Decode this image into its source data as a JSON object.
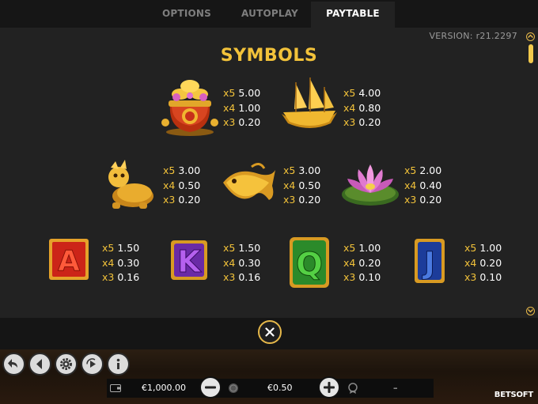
{
  "tabs": [
    {
      "label": "OPTIONS",
      "active": false
    },
    {
      "label": "AUTOPLAY",
      "active": false
    },
    {
      "label": "PAYTABLE",
      "active": true
    }
  ],
  "version": "VERSION: r21.2297",
  "section_title": "SYMBOLS",
  "symbols": [
    {
      "name": "treasure-pot",
      "pays": [
        {
          "mult": "x5",
          "value": "5.00"
        },
        {
          "mult": "x4",
          "value": "1.00"
        },
        {
          "mult": "x3",
          "value": "0.20"
        }
      ]
    },
    {
      "name": "golden-ship",
      "pays": [
        {
          "mult": "x5",
          "value": "4.00"
        },
        {
          "mult": "x4",
          "value": "0.80"
        },
        {
          "mult": "x3",
          "value": "0.20"
        }
      ]
    },
    {
      "name": "dragon-turtle",
      "pays": [
        {
          "mult": "x5",
          "value": "3.00"
        },
        {
          "mult": "x4",
          "value": "0.50"
        },
        {
          "mult": "x3",
          "value": "0.20"
        }
      ]
    },
    {
      "name": "golden-fish",
      "pays": [
        {
          "mult": "x5",
          "value": "3.00"
        },
        {
          "mult": "x4",
          "value": "0.50"
        },
        {
          "mult": "x3",
          "value": "0.20"
        }
      ]
    },
    {
      "name": "lotus-flower",
      "pays": [
        {
          "mult": "x5",
          "value": "2.00"
        },
        {
          "mult": "x4",
          "value": "0.40"
        },
        {
          "mult": "x3",
          "value": "0.20"
        }
      ]
    },
    {
      "name": "letter-a",
      "letter": "A",
      "pays": [
        {
          "mult": "x5",
          "value": "1.50"
        },
        {
          "mult": "x4",
          "value": "0.30"
        },
        {
          "mult": "x3",
          "value": "0.16"
        }
      ]
    },
    {
      "name": "letter-k",
      "letter": "K",
      "pays": [
        {
          "mult": "x5",
          "value": "1.50"
        },
        {
          "mult": "x4",
          "value": "0.30"
        },
        {
          "mult": "x3",
          "value": "0.16"
        }
      ]
    },
    {
      "name": "letter-q",
      "letter": "Q",
      "pays": [
        {
          "mult": "x5",
          "value": "1.00"
        },
        {
          "mult": "x4",
          "value": "0.20"
        },
        {
          "mult": "x3",
          "value": "0.10"
        }
      ]
    },
    {
      "name": "letter-j",
      "letter": "J",
      "pays": [
        {
          "mult": "x5",
          "value": "1.00"
        },
        {
          "mult": "x4",
          "value": "0.20"
        },
        {
          "mult": "x3",
          "value": "0.10"
        }
      ]
    }
  ],
  "footer": {
    "balance": "€1,000.00",
    "bet": "€0.50",
    "win": "–",
    "logo": "BETSOFT"
  },
  "colors": {
    "accent": "#f2c23a",
    "panel": "#222222",
    "tab_bar": "#161616"
  },
  "icons": [
    "close-icon",
    "back-icon",
    "sound-icon",
    "gear-icon",
    "autoplay-icon",
    "info-icon",
    "wallet-icon",
    "minus-icon",
    "plus-icon",
    "coins-icon",
    "win-icon",
    "scroll-up-icon",
    "scroll-down-icon"
  ]
}
